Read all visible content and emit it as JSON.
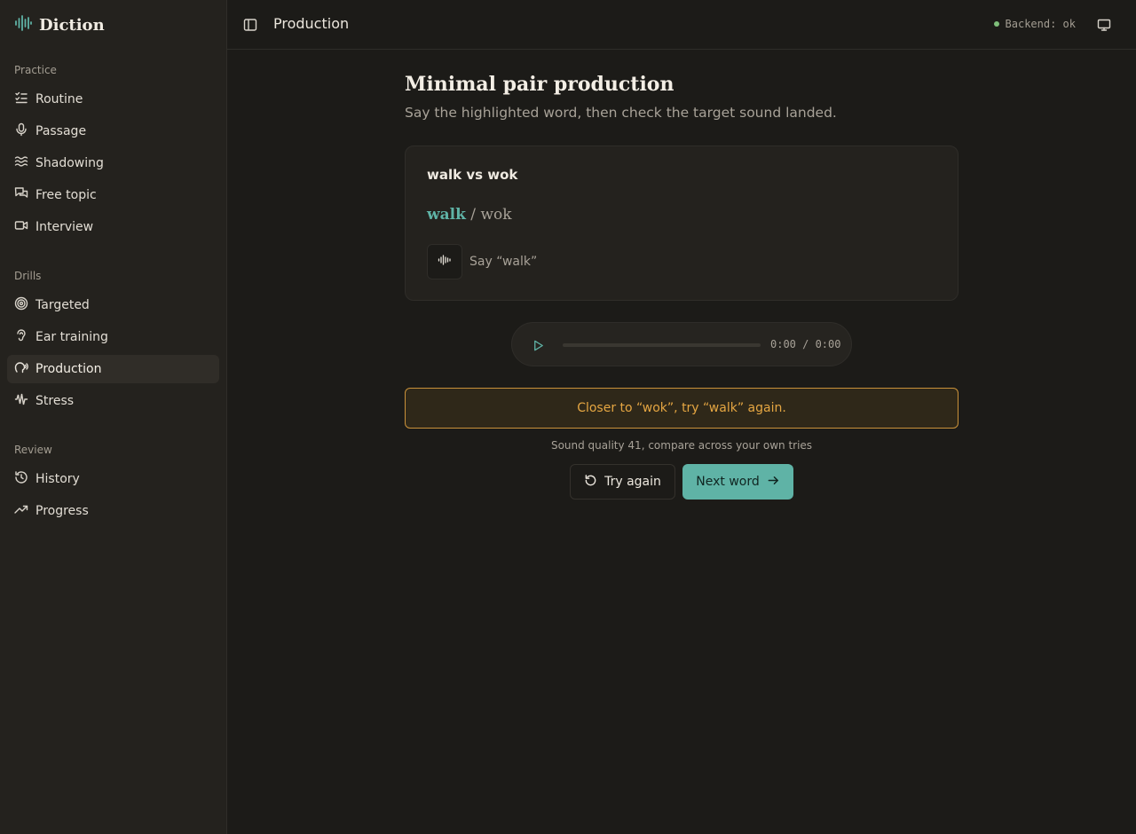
{
  "app": {
    "name": "Diction"
  },
  "sidebar": {
    "sections": [
      {
        "label": "Practice",
        "items": [
          {
            "label": "Routine",
            "icon": "list-checks-icon"
          },
          {
            "label": "Passage",
            "icon": "mic-icon"
          },
          {
            "label": "Shadowing",
            "icon": "waves-icon"
          },
          {
            "label": "Free topic",
            "icon": "chat-icon"
          },
          {
            "label": "Interview",
            "icon": "video-icon"
          }
        ]
      },
      {
        "label": "Drills",
        "items": [
          {
            "label": "Targeted",
            "icon": "target-icon"
          },
          {
            "label": "Ear training",
            "icon": "ear-icon"
          },
          {
            "label": "Production",
            "icon": "speech-icon",
            "active": true
          },
          {
            "label": "Stress",
            "icon": "audio-waveform-icon"
          }
        ]
      },
      {
        "label": "Review",
        "items": [
          {
            "label": "History",
            "icon": "history-icon"
          },
          {
            "label": "Progress",
            "icon": "trending-up-icon"
          }
        ]
      }
    ]
  },
  "header": {
    "title": "Production",
    "backend_status": "Backend: ok",
    "status_color": "#7fbf7a"
  },
  "main": {
    "title": "Minimal pair production",
    "subtitle": "Say the highlighted word, then check the target sound landed.",
    "card": {
      "title": "walk vs wok",
      "target_word": "walk",
      "separator": " / ",
      "other_word": "wok",
      "say_label": "Say “walk”"
    },
    "player": {
      "time": "0:00 / 0:00",
      "progress": 0
    },
    "feedback": "Closer to “wok”, try “walk” again.",
    "quality_note": "Sound quality 41, compare across your own tries",
    "buttons": {
      "try_again": "Try again",
      "next_word": "Next word"
    }
  },
  "colors": {
    "accent": "#5fb3a6",
    "warning": "#e5a642",
    "background": "#1c1b18",
    "sidebar": "#24221e"
  }
}
